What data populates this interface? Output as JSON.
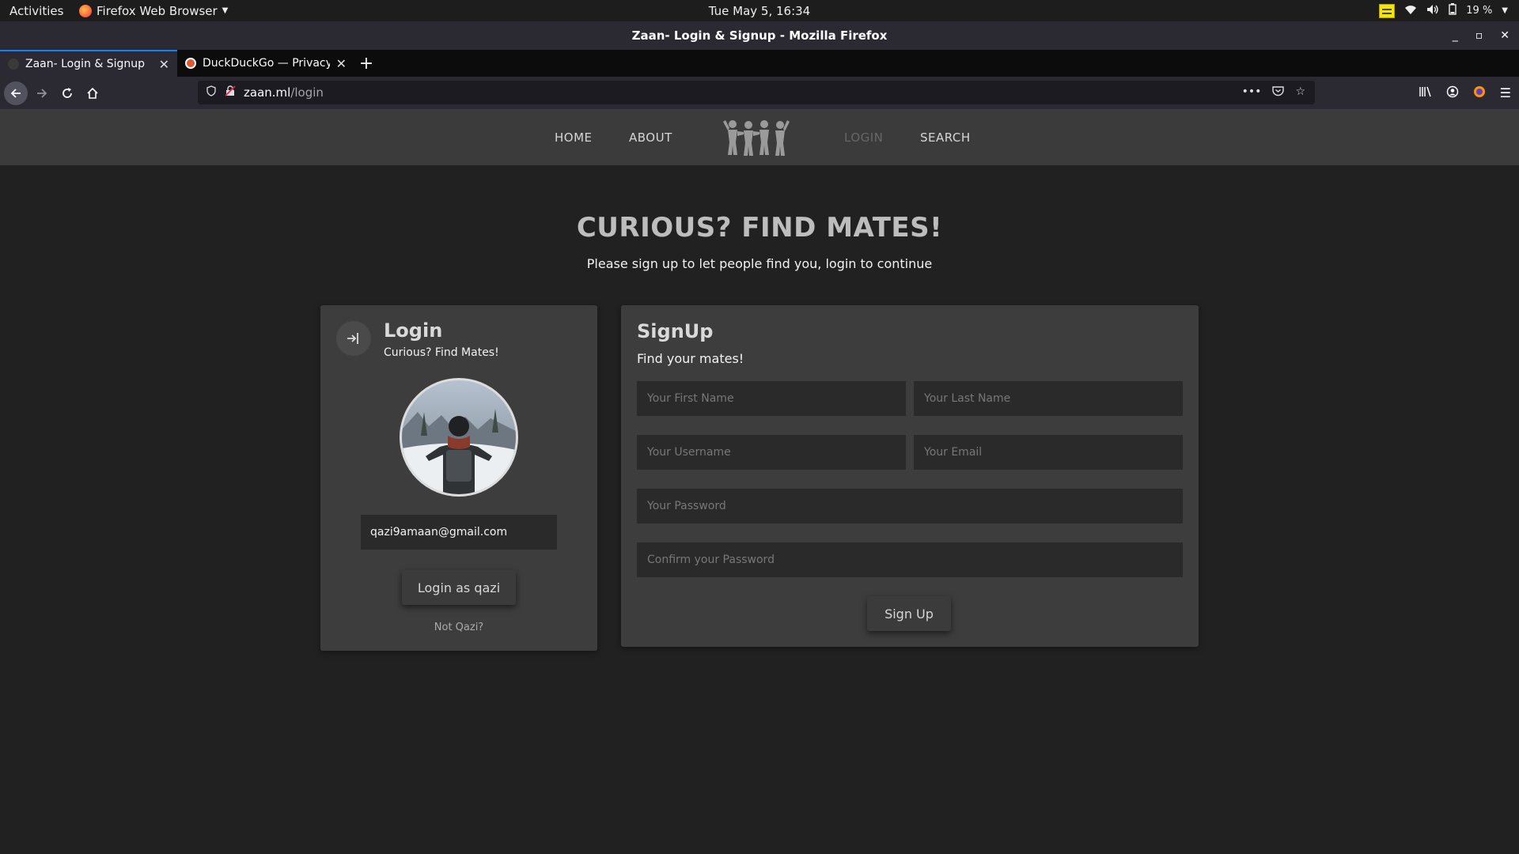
{
  "system_bar": {
    "activities": "Activities",
    "app_name": "Firefox Web Browser",
    "clock": "Tue May  5, 16:34",
    "battery": "19 %"
  },
  "window": {
    "title": "Zaan- Login & Signup - Mozilla Firefox"
  },
  "tabs": [
    {
      "title": "Zaan- Login & Signup",
      "active": true
    },
    {
      "title": "DuckDuckGo — Privacy, simplified.",
      "active": false
    }
  ],
  "urlbar": {
    "host": "zaan.ml",
    "path": "/login"
  },
  "site_nav": {
    "home": "HOME",
    "about": "ABOUT",
    "login": "LOGIN",
    "search": "SEARCH"
  },
  "hero": {
    "title": "CURIOUS? FIND MATES!",
    "subtitle": "Please sign up to let people find you, login to continue"
  },
  "login": {
    "heading": "Login",
    "subtitle": "Curious? Find Mates!",
    "email_value": "qazi9amaan@gmail.com",
    "button": "Login as qazi",
    "not_user": "Not Qazi?"
  },
  "signup": {
    "heading": "SignUp",
    "subtitle": "Find your mates!",
    "first_name_placeholder": "Your First Name",
    "last_name_placeholder": "Your Last Name",
    "username_placeholder": "Your Username",
    "email_placeholder": "Your Email",
    "password_placeholder": "Your Password",
    "confirm_placeholder": "Confirm your Password",
    "button": "Sign Up"
  },
  "colors": {
    "page_bg": "#212121",
    "card_bg": "#3d3d3d",
    "header_bg": "#3b3b3b",
    "input_bg": "#2a2a2a",
    "accent_tab": "#0a84ff"
  }
}
